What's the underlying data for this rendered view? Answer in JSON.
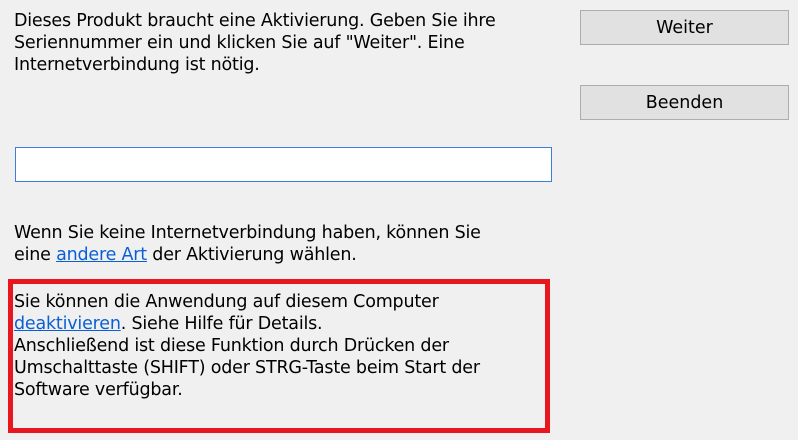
{
  "dialog": {
    "intro": {
      "line1": "Dieses Produkt braucht eine Aktivierung. Geben Sie ihre",
      "line2": "Seriennummer ein und klicken Sie auf \"Weiter\". Eine",
      "line3": "Internetverbindung ist nötig."
    },
    "serial_input": {
      "value": "",
      "placeholder": ""
    },
    "buttons": {
      "next_label": "Weiter",
      "quit_label": "Beenden"
    },
    "offline": {
      "line1": "Wenn Sie keine Internetverbindung haben, können Sie",
      "line2_pre": "eine ",
      "line2_link": "andere Art",
      "line2_post": " der Aktivierung wählen."
    },
    "deactivate": {
      "line1": "Sie können die Anwendung auf diesem Computer",
      "line2_link": "deaktivieren",
      "line2_post": ". Siehe Hilfe für Details.",
      "line3": "Anschließend ist diese Funktion durch Drücken der",
      "line4": "Umschalttaste (SHIFT) oder STRG-Taste beim Start der",
      "line5": "Software verfügbar."
    },
    "colors": {
      "highlight": "#e8161f",
      "link": "#0a5fd6",
      "input_border": "#3c7fd8"
    }
  }
}
